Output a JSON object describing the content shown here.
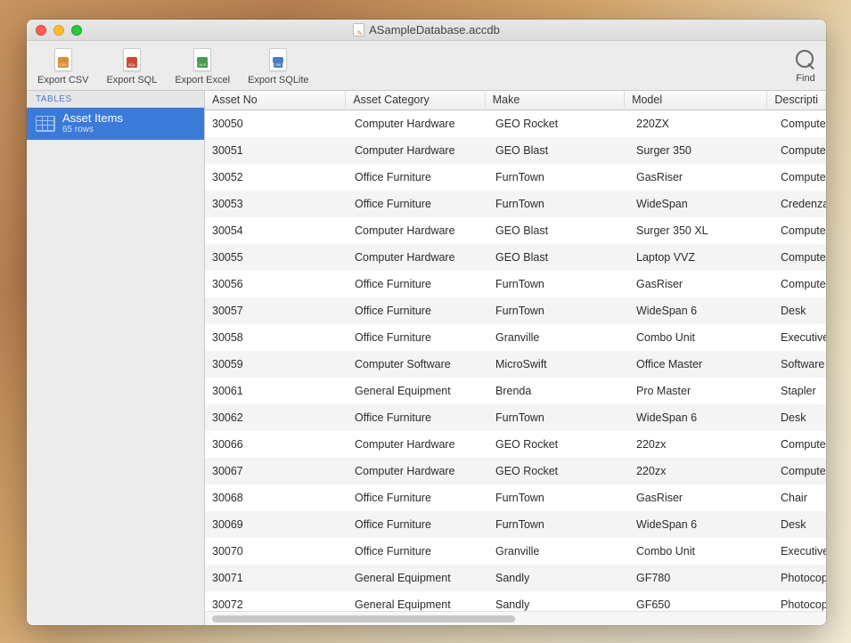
{
  "window": {
    "title": "ASampleDatabase.accdb"
  },
  "toolbar": {
    "exportCsv": "Export CSV",
    "exportSql": "Export SQL",
    "exportExcel": "Export Excel",
    "exportSqlite": "Export SQLite",
    "find": "Find"
  },
  "sidebar": {
    "sectionLabel": "TABLES",
    "table": {
      "name": "Asset Items",
      "rows": "65 rows"
    }
  },
  "grid": {
    "columns": [
      "Asset No",
      "Asset Category",
      "Make",
      "Model",
      "Descripti"
    ],
    "rows": [
      [
        "30050",
        "Computer Hardware",
        "GEO Rocket",
        "220ZX",
        "Compute"
      ],
      [
        "30051",
        "Computer Hardware",
        "GEO Blast",
        "Surger 350",
        "Compute"
      ],
      [
        "30052",
        "Office Furniture",
        "FurnTown",
        "GasRiser",
        "Compute"
      ],
      [
        "30053",
        "Office Furniture",
        "FurnTown",
        "WideSpan",
        "Credenza"
      ],
      [
        "30054",
        "Computer Hardware",
        "GEO Blast",
        "Surger 350 XL",
        "Compute"
      ],
      [
        "30055",
        "Computer Hardware",
        "GEO Blast",
        "Laptop VVZ",
        "Compute"
      ],
      [
        "30056",
        "Office Furniture",
        "FurnTown",
        "GasRiser",
        "Compute"
      ],
      [
        "30057",
        "Office Furniture",
        "FurnTown",
        "WideSpan 6",
        "Desk"
      ],
      [
        "30058",
        "Office Furniture",
        "Granville",
        "Combo Unit",
        "Executive"
      ],
      [
        "30059",
        "Computer Software",
        "MicroSwift",
        "Office Master",
        "Software"
      ],
      [
        "30061",
        "General Equipment",
        "Brenda",
        "Pro Master",
        "Stapler"
      ],
      [
        "30062",
        "Office Furniture",
        "FurnTown",
        "WideSpan 6",
        "Desk"
      ],
      [
        "30066",
        "Computer Hardware",
        "GEO Rocket",
        "220zx",
        "Compute"
      ],
      [
        "30067",
        "Computer Hardware",
        "GEO Rocket",
        "220zx",
        "Compute"
      ],
      [
        "30068",
        "Office Furniture",
        "FurnTown",
        "GasRiser",
        "Chair"
      ],
      [
        "30069",
        "Office Furniture",
        "FurnTown",
        "WideSpan 6",
        "Desk"
      ],
      [
        "30070",
        "Office Furniture",
        "Granville",
        "Combo Unit",
        "Executive"
      ],
      [
        "30071",
        "General Equipment",
        "Sandly",
        "GF780",
        "Photocop"
      ],
      [
        "30072",
        "General Equipment",
        "Sandly",
        "GF650",
        "Photocop"
      ]
    ]
  }
}
